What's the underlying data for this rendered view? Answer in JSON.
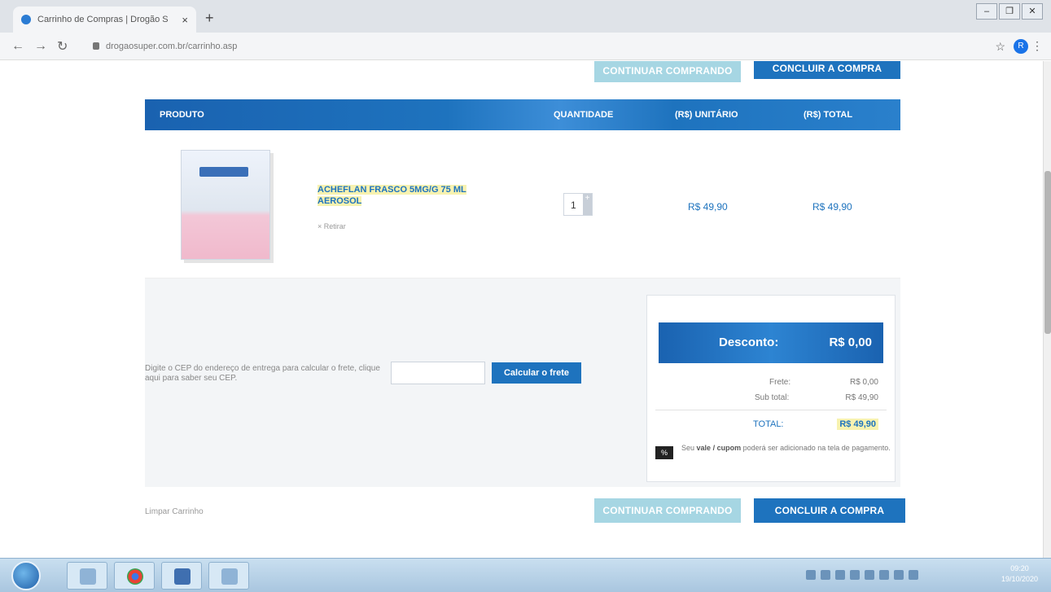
{
  "browser": {
    "tab_title": "Carrinho de Compras | Drogão S",
    "tab_close": "×",
    "new_tab": "+",
    "url": "drogaosuper.com.br/carrinho.asp",
    "profile_initial": "R",
    "window_controls": [
      "–",
      "❐",
      "✕"
    ]
  },
  "actions": {
    "continue_shopping": "CONTINUAR COMPRANDO",
    "checkout": "CONCLUIR A COMPRA"
  },
  "table": {
    "columns": [
      "PRODUTO",
      "QUANTIDADE",
      "(R$) UNITÁRIO",
      "(R$) TOTAL"
    ]
  },
  "product": {
    "name": "ACHEFLAN FRASCO 5MG/G 75 ML AEROSOL",
    "remove_label": "Retirar",
    "quantity": "1",
    "unit_price": "R$ 49,90",
    "total_price": "R$ 49,90"
  },
  "shipping": {
    "instructions": "Digite o CEP do endereço de entrega para calcular o frete, clique aqui para saber seu CEP.",
    "cep_value": "",
    "calc_button": "Calcular o frete"
  },
  "summary": {
    "discount_label": "Desconto:",
    "discount_value": "R$ 0,00",
    "freight_label": "Frete:",
    "freight_value": "R$ 0,00",
    "subtotal_label": "Sub total:",
    "subtotal_value": "R$ 49,90",
    "total_label": "TOTAL:",
    "total_value": "R$ 49,90",
    "coupon_icon": "%",
    "coupon_pre": "Seu",
    "coupon_vale": "vale",
    "coupon_mid": "/",
    "coupon_cupom": "cupom",
    "coupon_post": "poderá ser adicionado na tela de pagamento."
  },
  "footer": {
    "clear_cart": "Limpar Carrinho"
  },
  "taskbar": {
    "time": "09:20",
    "date": "19/10/2020"
  },
  "colors": {
    "brand_blue": "#1e73be",
    "light_button": "#a6d6e3",
    "highlight": "#f7f2b0"
  }
}
